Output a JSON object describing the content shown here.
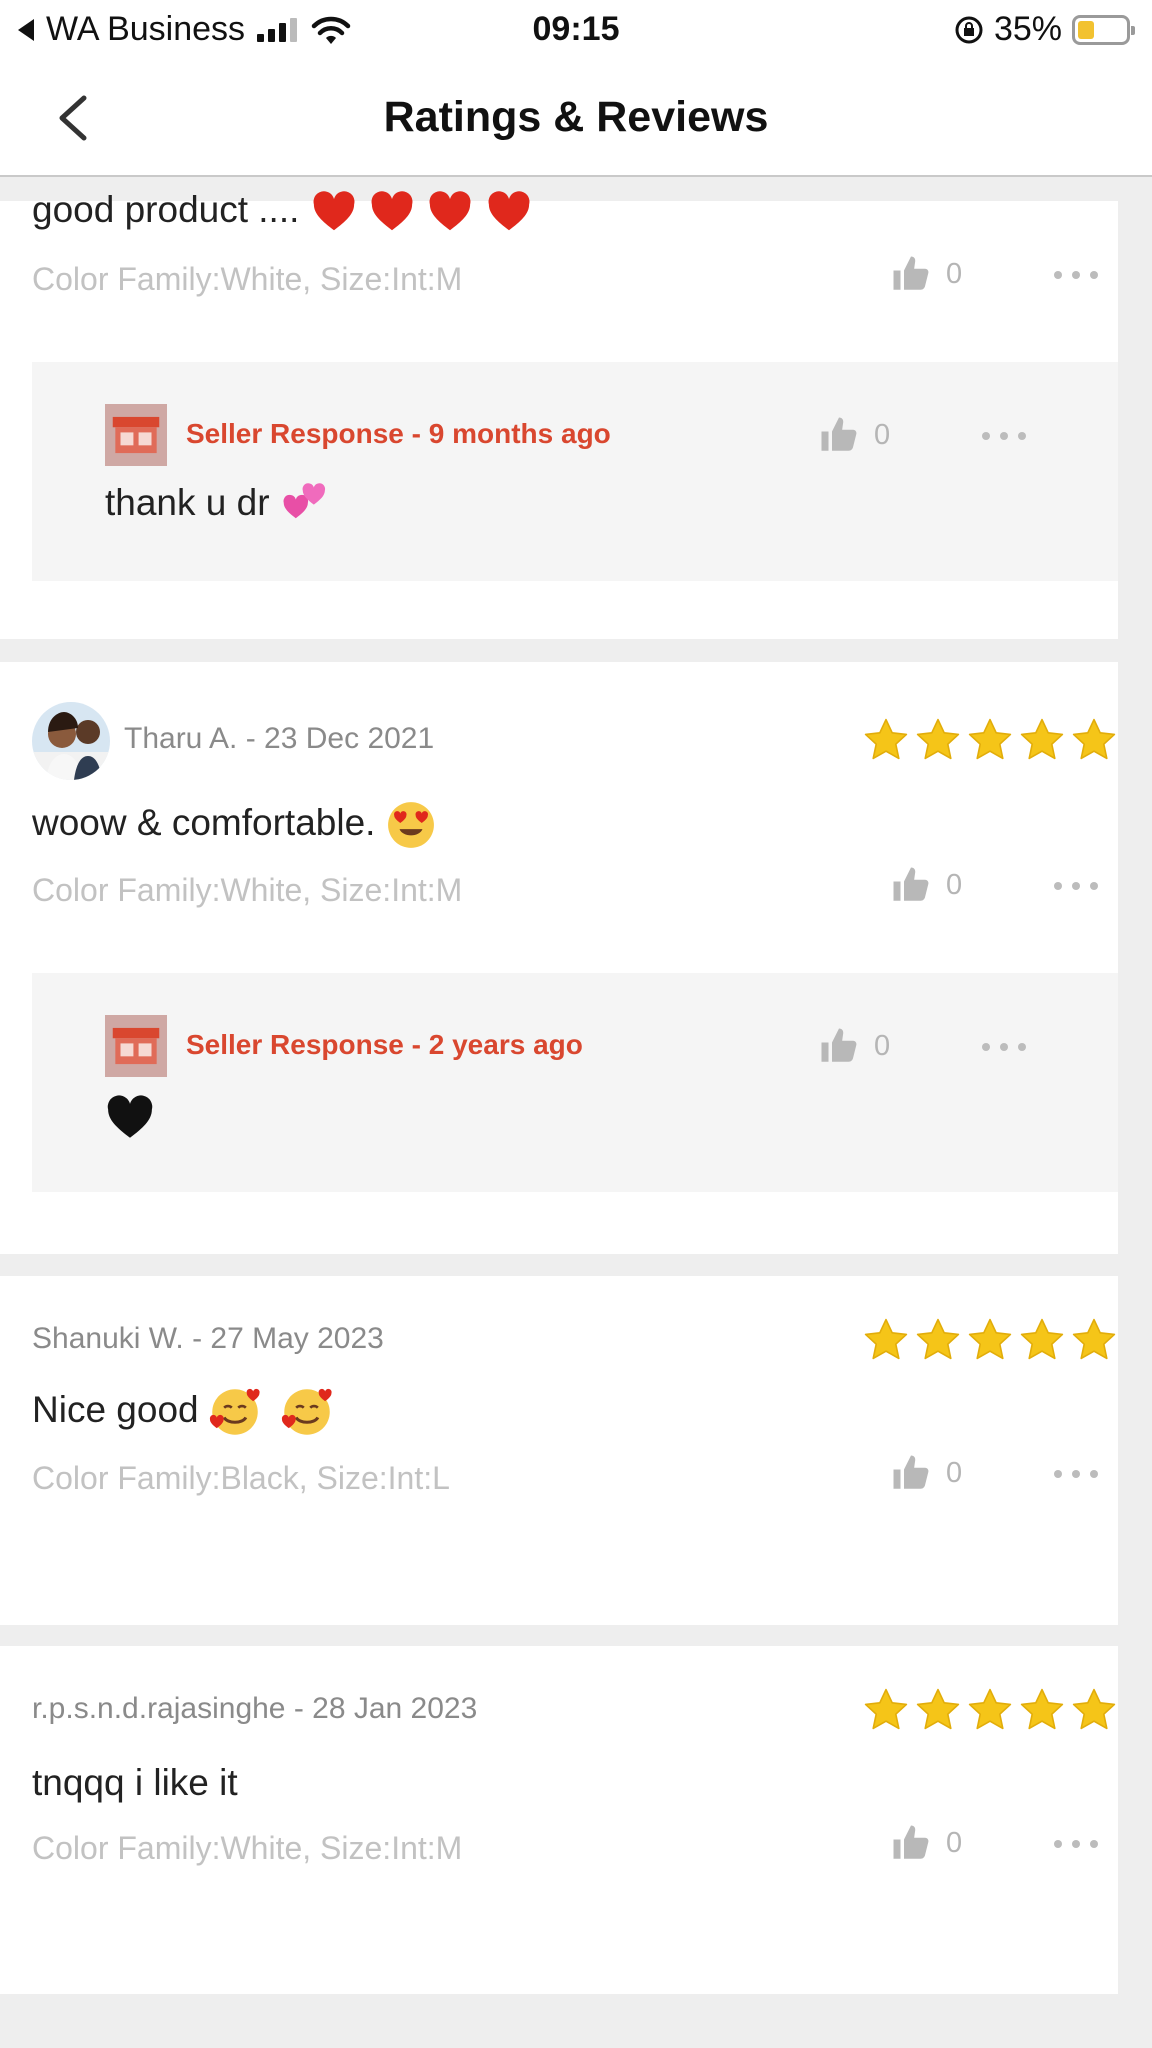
{
  "status_bar": {
    "carrier": "WA Business",
    "time": "09:15",
    "battery": "35%",
    "battery_level": 0.35
  },
  "header": {
    "title": "Ratings & Reviews"
  },
  "reviews": [
    {
      "text": "good product ....",
      "variant": "Color Family:White, Size:Int:M",
      "likes": "0",
      "seller_response": {
        "title": "Seller Response - 9  months ago",
        "text": "thank u dr",
        "likes": "0"
      }
    },
    {
      "reviewer": "Tharu A. - 23 Dec 2021",
      "rating": 5,
      "text": "woow  & comfortable.",
      "variant": "Color Family:White, Size:Int:M",
      "likes": "0",
      "seller_response": {
        "title": "Seller Response - 2  years ago",
        "text": "",
        "likes": "0"
      }
    },
    {
      "reviewer": "Shanuki W. - 27 May 2023",
      "rating": 5,
      "text": "Nice good",
      "variant": "Color Family:Black, Size:Int:L",
      "likes": "0"
    },
    {
      "reviewer": "r.p.s.n.d.rajasinghe - 28 Jan 2023",
      "rating": 5,
      "text": "tnqqq i like it",
      "variant": "Color Family:White, Size:Int:M",
      "likes": "0"
    }
  ],
  "colors": {
    "star": "#f5c518",
    "seller_red": "#d9472f",
    "muted_text": "#c2c2c2"
  }
}
